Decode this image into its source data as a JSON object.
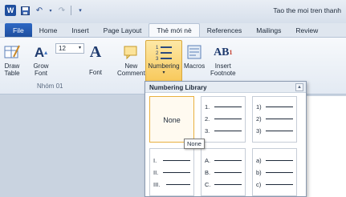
{
  "window": {
    "title": "Tao the moi tren thanh"
  },
  "qat": {
    "icons": [
      "word-icon",
      "save-icon",
      "undo-icon",
      "redo-icon",
      "customize-icon"
    ]
  },
  "tabs": [
    {
      "label": "File"
    },
    {
      "label": "Home"
    },
    {
      "label": "Insert"
    },
    {
      "label": "Page Layout"
    },
    {
      "label": "Thẻ mới nè",
      "active": true
    },
    {
      "label": "References"
    },
    {
      "label": "Mailings"
    },
    {
      "label": "Review"
    }
  ],
  "ribbon": {
    "draw_table": "Draw\nTable",
    "grow_font": "Grow\nFont",
    "font_size": "12",
    "font": "Font",
    "new_comment": "New\nComment",
    "numbering": "Numbering",
    "macros": "Macros",
    "insert_footnote": "Insert\nFootnote",
    "group_label": "Nhóm 01"
  },
  "gallery": {
    "title": "Numbering Library",
    "none_label": "None",
    "tooltip": "None",
    "formats": [
      [
        "1.",
        "2.",
        "3."
      ],
      [
        "1)",
        "2)",
        "3)"
      ],
      [
        "I.",
        "II.",
        "III."
      ],
      [
        "A.",
        "B.",
        "C."
      ],
      [
        "a)",
        "b)",
        "c)"
      ]
    ]
  }
}
